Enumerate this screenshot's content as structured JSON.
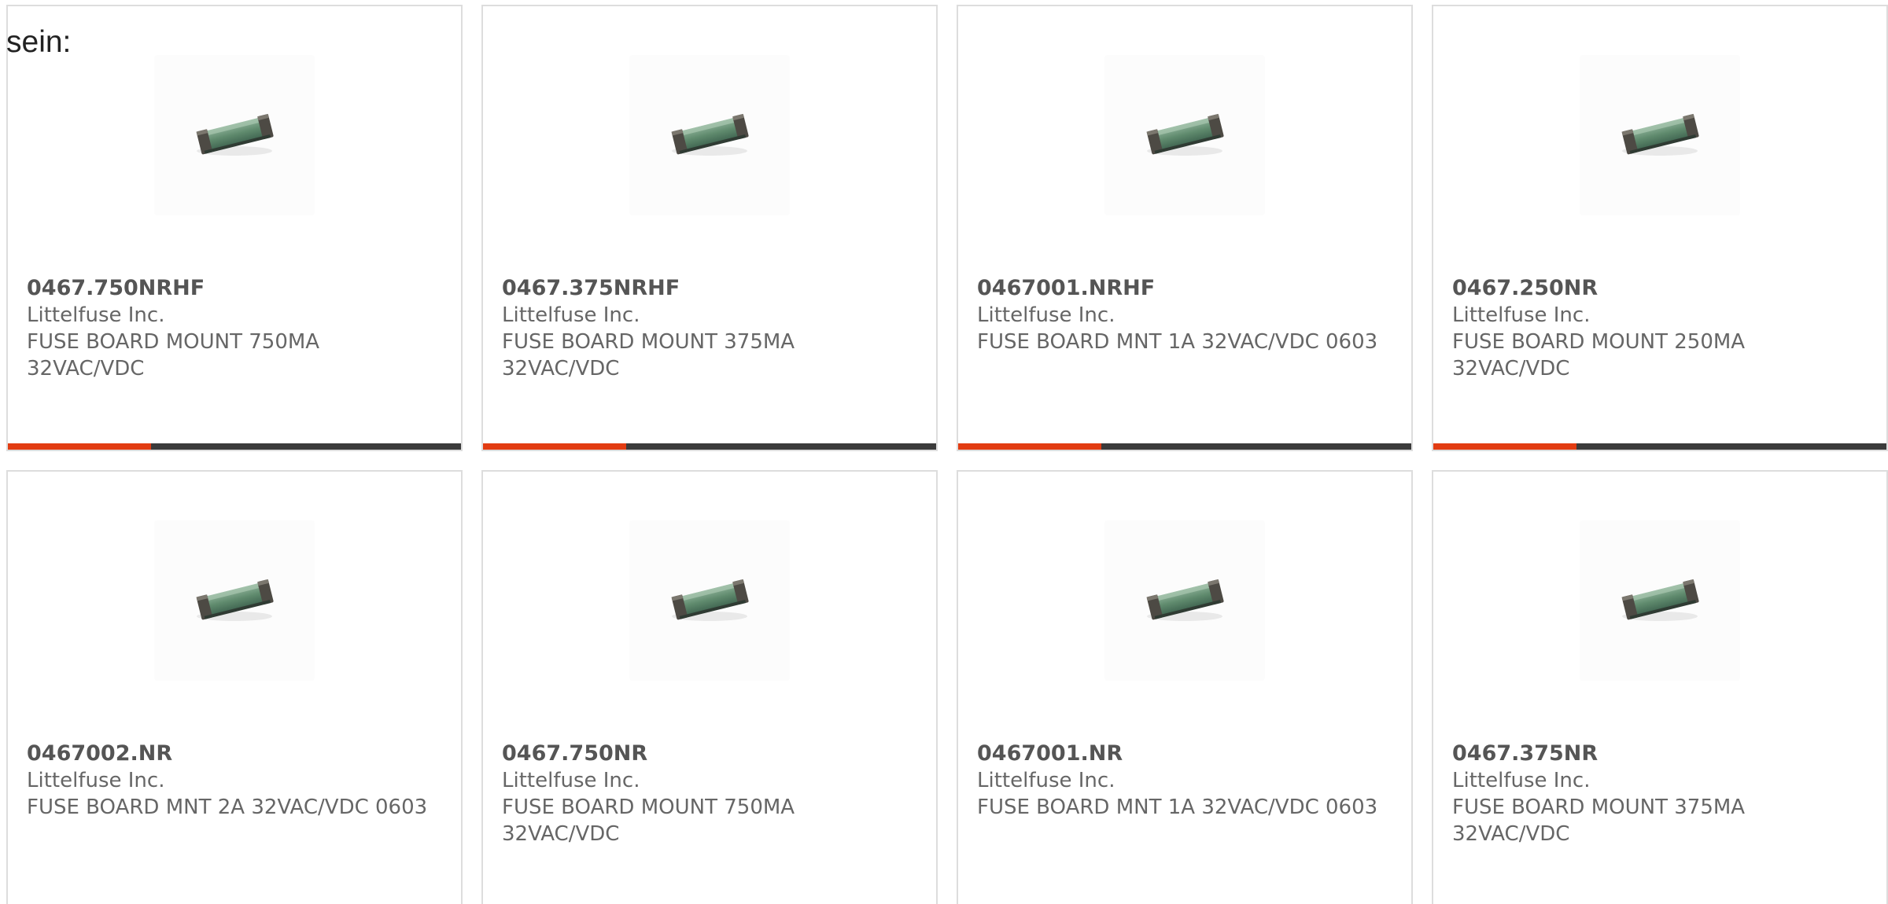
{
  "intro": {
    "text": "sein:"
  },
  "products": [
    {
      "part_number": "0467.750NRHF",
      "manufacturer": "Littelfuse Inc.",
      "description": "FUSE BOARD MOUNT 750MA 32VAC/VDC"
    },
    {
      "part_number": "0467.375NRHF",
      "manufacturer": "Littelfuse Inc.",
      "description": "FUSE BOARD MOUNT 375MA 32VAC/VDC"
    },
    {
      "part_number": "0467001.NRHF",
      "manufacturer": "Littelfuse Inc.",
      "description": "FUSE BOARD MNT 1A 32VAC/VDC 0603"
    },
    {
      "part_number": "0467.250NR",
      "manufacturer": "Littelfuse Inc.",
      "description": "FUSE BOARD MOUNT 250MA 32VAC/VDC"
    },
    {
      "part_number": "0467002.NR",
      "manufacturer": "Littelfuse Inc.",
      "description": "FUSE BOARD MNT 2A 32VAC/VDC 0603"
    },
    {
      "part_number": "0467.750NR",
      "manufacturer": "Littelfuse Inc.",
      "description": "FUSE BOARD MOUNT 750MA 32VAC/VDC"
    },
    {
      "part_number": "0467001.NR",
      "manufacturer": "Littelfuse Inc.",
      "description": "FUSE BOARD MNT 1A 32VAC/VDC 0603"
    },
    {
      "part_number": "0467.375NR",
      "manufacturer": "Littelfuse Inc.",
      "description": "FUSE BOARD MOUNT 375MA 32VAC/VDC"
    }
  ],
  "colors": {
    "accent": "#e23c12",
    "bar_dark": "#3b3b3b",
    "card_border": "#dddddd",
    "text": "#666666"
  },
  "icons": {
    "product_image": "smd-fuse-image"
  }
}
